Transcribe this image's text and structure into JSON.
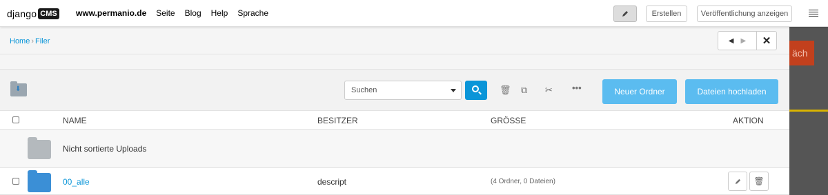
{
  "toolbar": {
    "logo_text": "django",
    "logo_badge": "CMS",
    "site": "www.permanio.de",
    "menu": [
      "Seite",
      "Blog",
      "Help",
      "Sprache"
    ],
    "edit_icon": "pencil-icon",
    "create_label": "Erstellen",
    "publish_label": "Veröffentlichung anzeigen"
  },
  "backdrop": {
    "partial_button_text": "äch"
  },
  "modal": {
    "breadcrumb": {
      "home": "Home",
      "separator": "›",
      "current": "Filer"
    },
    "nav_icons": [
      "triangle-left-icon",
      "triangle-right-icon"
    ],
    "close_icon": "close-icon"
  },
  "actions": {
    "search_placeholder": "Suchen",
    "search_icon": "search-icon",
    "tool_icons": [
      "trash-icon",
      "copy-icon",
      "scissors-icon",
      "more-icon"
    ],
    "new_folder_label": "Neuer Ordner",
    "upload_label": "Dateien hochladen"
  },
  "table": {
    "headers": {
      "name": "NAME",
      "owner": "BESITZER",
      "size": "GRÖSSE",
      "action": "AKTION"
    },
    "unsorted": {
      "name": "Nicht sortierte Uploads"
    },
    "rows": [
      {
        "name": "00_alle",
        "owner": "descript",
        "size": "(4 Ordner, 0 Dateien)"
      }
    ]
  },
  "colors": {
    "accent": "#0a95d8",
    "button_blue": "#5bbcf0",
    "folder_blue": "#3b8fd6",
    "folder_grey": "#b4b9bd",
    "backdrop_orange": "#c2401d"
  }
}
